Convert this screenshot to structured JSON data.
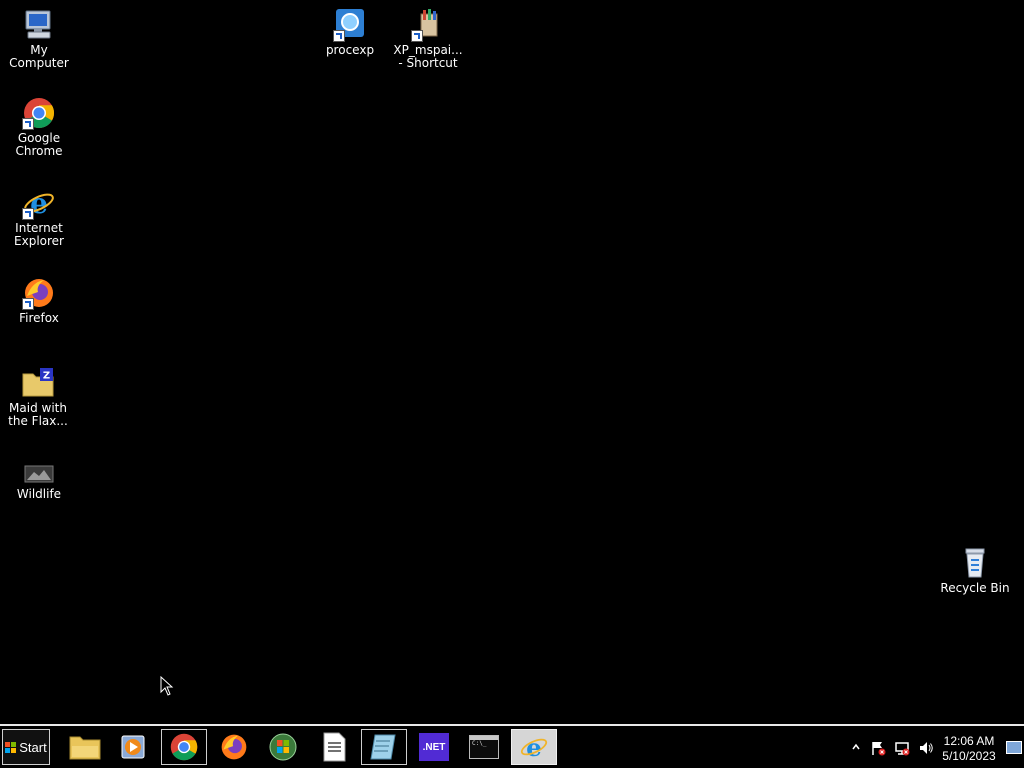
{
  "desktop": {
    "icons": [
      {
        "label": "My Computer"
      },
      {
        "label": "Google Chrome"
      },
      {
        "label": "Internet Explorer"
      },
      {
        "label": "Firefox"
      },
      {
        "label": "Maid with the Flax..."
      },
      {
        "label": "Wildlife"
      },
      {
        "label": "procexp"
      },
      {
        "label": "XP_mspai... - Shortcut"
      },
      {
        "label": "Recycle Bin"
      }
    ]
  },
  "taskbar": {
    "start_label": "Start",
    "pinned": [
      {
        "name": "file-explorer",
        "icon": "folder-icon"
      },
      {
        "name": "media-player",
        "icon": "media-player-icon"
      },
      {
        "name": "google-chrome",
        "icon": "chrome-icon",
        "state": "active"
      },
      {
        "name": "firefox",
        "icon": "firefox-icon"
      },
      {
        "name": "windows",
        "icon": "windows-orb-icon"
      },
      {
        "name": "document",
        "icon": "document-icon"
      },
      {
        "name": "notepad",
        "icon": "notepad-icon",
        "state": "active"
      },
      {
        "name": "dotnet",
        "icon": "dotnet-icon",
        "text": ".NET"
      },
      {
        "name": "command-prompt",
        "icon": "cmd-icon",
        "text": "C:\\_"
      },
      {
        "name": "internet-explorer",
        "icon": "ie-icon",
        "state": "pressed"
      }
    ],
    "clock": {
      "time": "12:06 AM",
      "date": "5/10/2023"
    }
  },
  "colors": {
    "desktop_bg": "#000000",
    "taskbar_border": "#e8e8e8",
    "dotnet": "#512bd4"
  }
}
